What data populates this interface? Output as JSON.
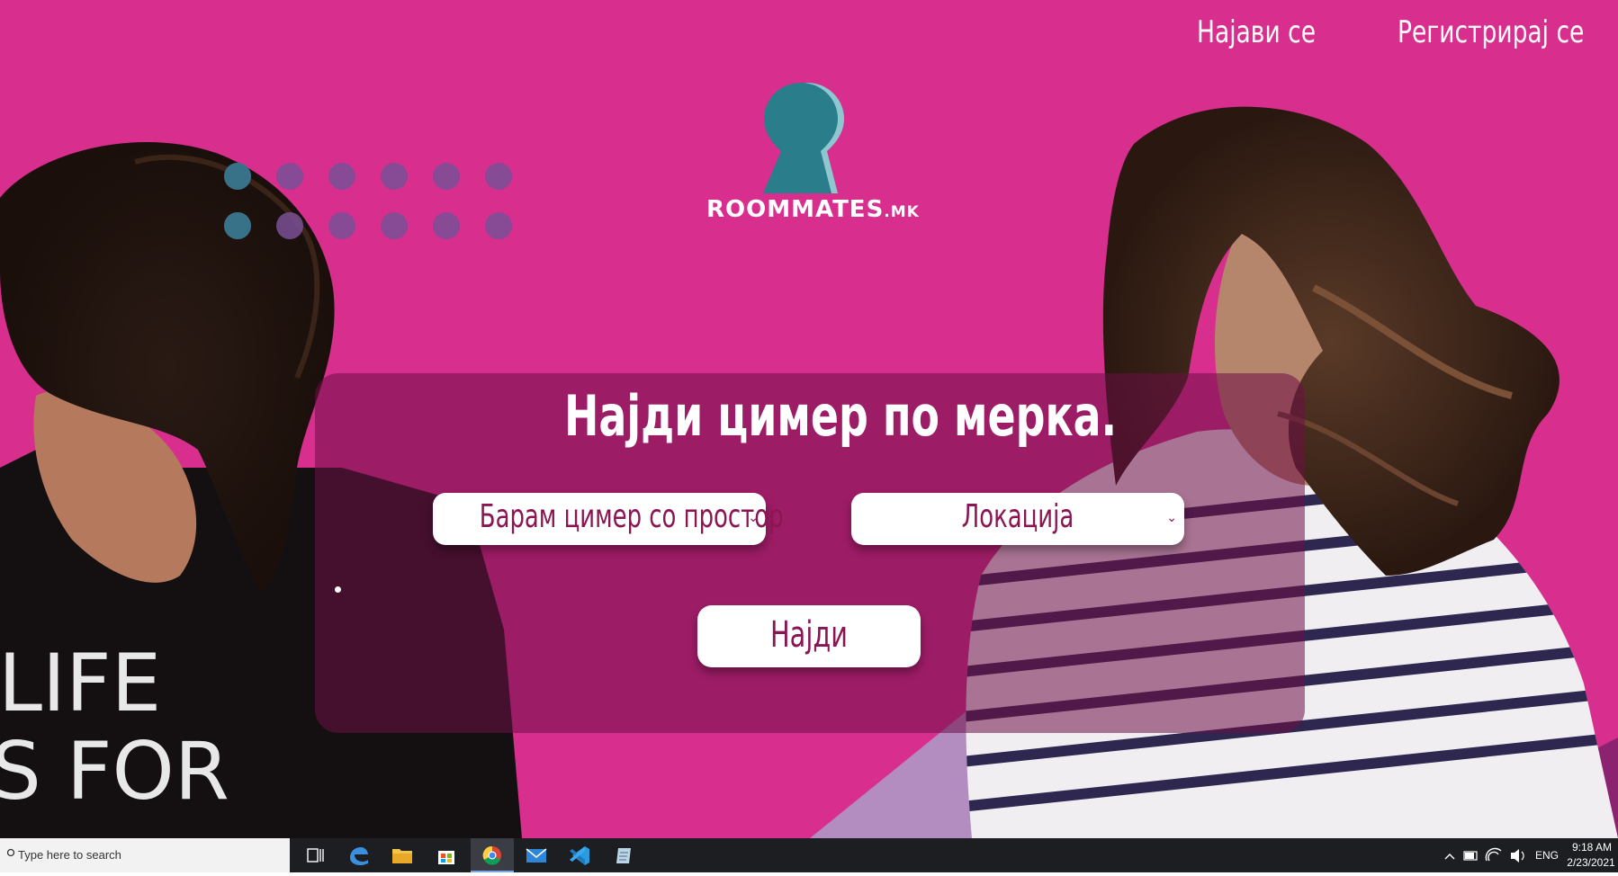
{
  "nav": {
    "login": "Најави се",
    "register": "Регистрирај се"
  },
  "logo": {
    "text": "ROOMMATES",
    "suffix": ".MK"
  },
  "search": {
    "headline": "Најди цимер по мерка.",
    "type_select": "Барам цимер со простор",
    "location_select": "Локација",
    "find_button": "Најди"
  },
  "shirt_text": {
    "line1": "LIFE",
    "line2": "S FOR"
  },
  "taskbar": {
    "search_placeholder": "Type here to search",
    "language": "ENG",
    "time": "9:18 AM",
    "date": "2/23/2021"
  },
  "colors": {
    "background": "#d42c8e",
    "accent": "#8b1552",
    "logo_teal": "#2a7d8a"
  }
}
